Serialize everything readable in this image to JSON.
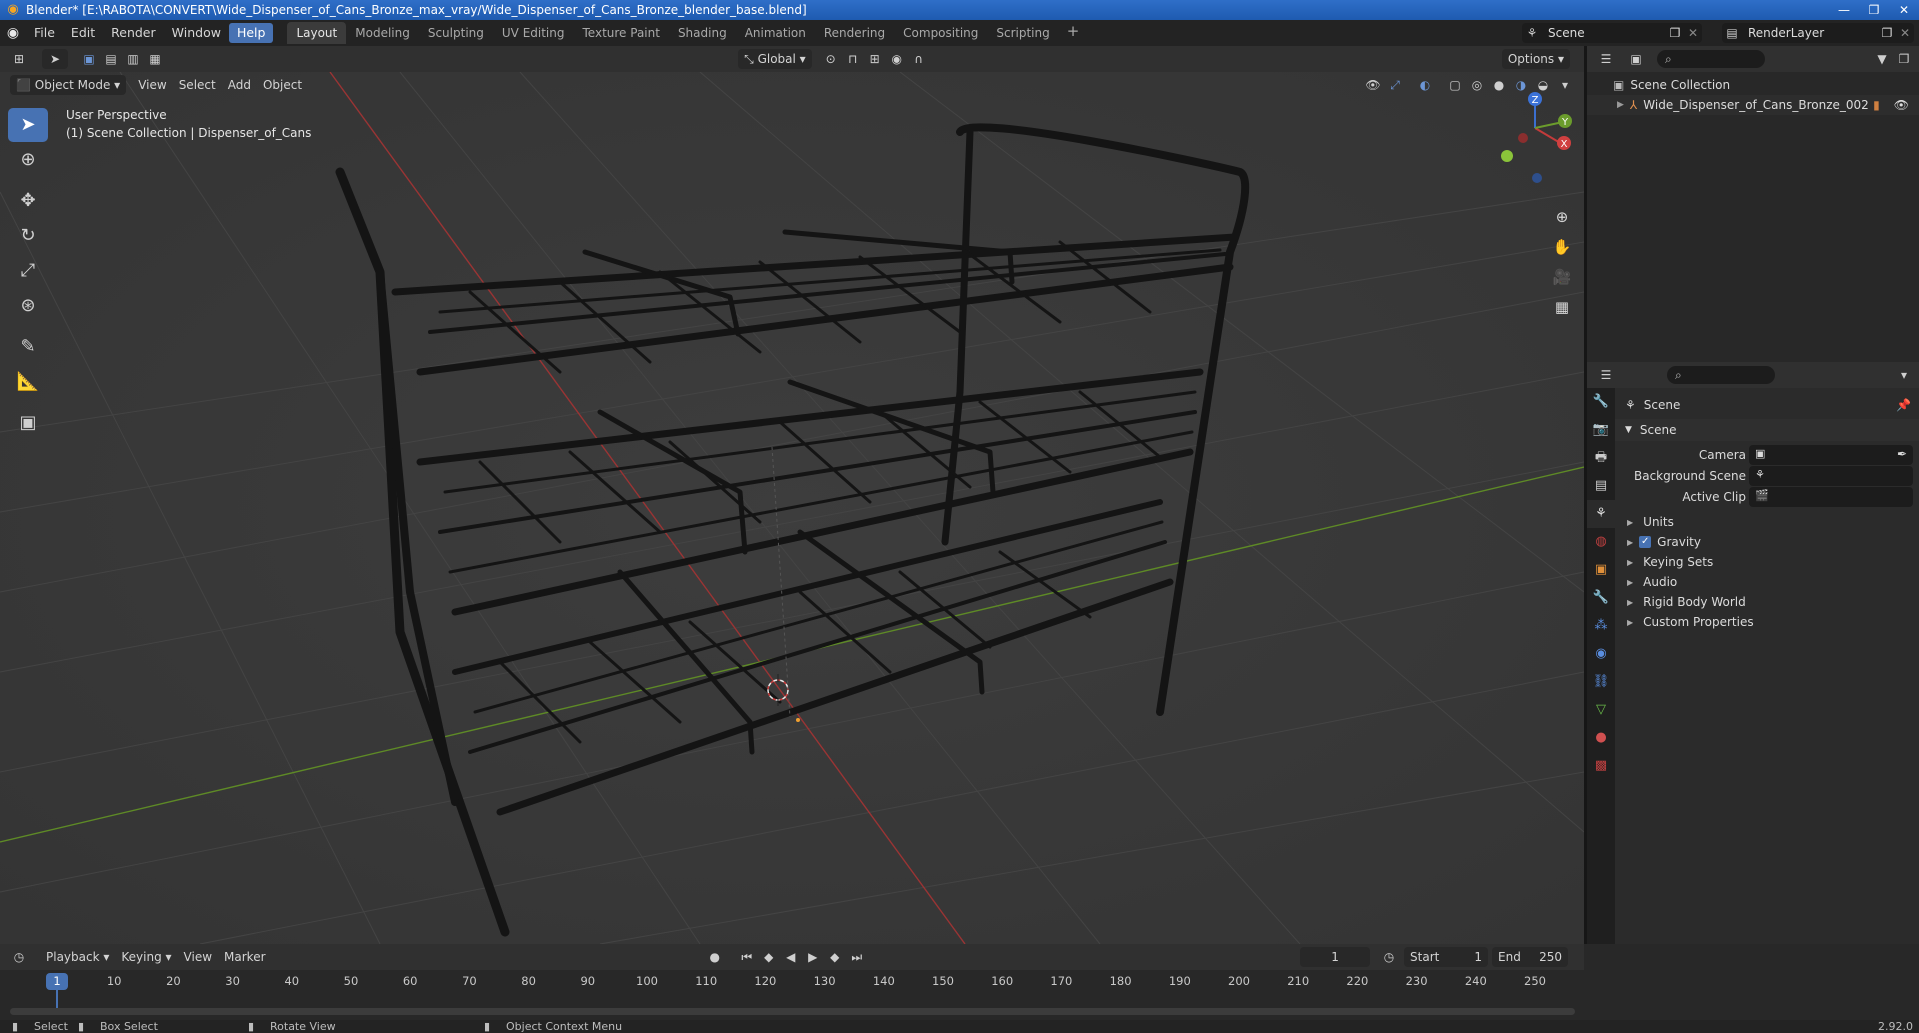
{
  "window": {
    "title": "Blender* [E:\\RABOTA\\CONVERT\\Wide_Dispenser_of_Cans_Bronze_max_vray/Wide_Dispenser_of_Cans_Bronze_blender_base.blend]"
  },
  "menus": [
    "File",
    "Edit",
    "Render",
    "Window",
    "Help"
  ],
  "workspaces": [
    "Layout",
    "Modeling",
    "Sculpting",
    "UV Editing",
    "Texture Paint",
    "Shading",
    "Animation",
    "Rendering",
    "Compositing",
    "Scripting"
  ],
  "active_workspace": "Layout",
  "active_menu": "Help",
  "scene_name": "Scene",
  "view_layer": "RenderLayer",
  "viewport": {
    "mode": "Object Mode",
    "header_menus": [
      "View",
      "Select",
      "Add",
      "Object"
    ],
    "transform_orientation": "Global",
    "options_label": "Options",
    "perspective_label": "User Perspective",
    "collection_label": "(1) Scene Collection | Dispenser_of_Cans",
    "gizmo_axes": {
      "z": "Z",
      "y": "Y",
      "x": "X"
    }
  },
  "outliner": {
    "root": "Scene Collection",
    "items": [
      {
        "name": "Wide_Dispenser_of_Cans_Bronze_002"
      }
    ]
  },
  "properties": {
    "context_title": "Scene",
    "panel_title": "Scene",
    "fields": [
      {
        "label": "Camera",
        "value": ""
      },
      {
        "label": "Background Scene",
        "value": ""
      },
      {
        "label": "Active Clip",
        "value": ""
      }
    ],
    "sections": [
      {
        "label": "Units",
        "checkbox": false
      },
      {
        "label": "Gravity",
        "checkbox": true,
        "checked": true
      },
      {
        "label": "Keying Sets",
        "checkbox": false
      },
      {
        "label": "Audio",
        "checkbox": false
      },
      {
        "label": "Rigid Body World",
        "checkbox": false
      },
      {
        "label": "Custom Properties",
        "checkbox": false
      }
    ]
  },
  "timeline": {
    "menus": [
      "Playback",
      "Keying",
      "View",
      "Marker"
    ],
    "current_frame": "1",
    "start_label": "Start",
    "start": "1",
    "end_label": "End",
    "end": "250",
    "ruler": [
      "1",
      "10",
      "20",
      "30",
      "40",
      "50",
      "60",
      "70",
      "80",
      "90",
      "100",
      "110",
      "120",
      "130",
      "140",
      "150",
      "160",
      "170",
      "180",
      "190",
      "200",
      "210",
      "220",
      "230",
      "240",
      "250"
    ]
  },
  "statusbar": {
    "select": "Select",
    "box_select": "Box Select",
    "rotate_view": "Rotate View",
    "context_menu": "Object Context Menu",
    "version": "2.92.0"
  },
  "colors": {
    "accent": "#4772b3",
    "x_axis": "#b33a3a",
    "y_axis": "#6b9c2c"
  }
}
